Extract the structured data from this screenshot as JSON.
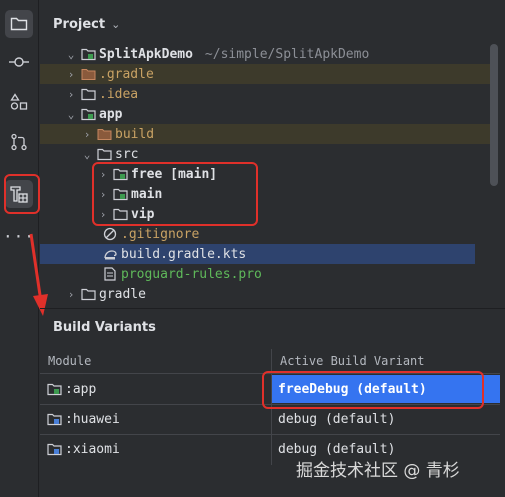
{
  "project": {
    "title": "Project",
    "chevron": "⌄"
  },
  "tree": {
    "root": {
      "name": "SplitApkDemo",
      "path": "~/simple/SplitApkDemo"
    },
    "gradle_dir": ".gradle",
    "idea_dir": ".idea",
    "app": "app",
    "build": "build",
    "src": "src",
    "src_children": [
      "free [main]",
      "main",
      "vip"
    ],
    "gitignore": ".gitignore",
    "build_gradle": "build.gradle.kts",
    "proguard": "proguard-rules.pro",
    "gradle": "gradle"
  },
  "build_variants": {
    "title": "Build Variants",
    "headers": {
      "module": "Module",
      "variant": "Active Build Variant"
    },
    "rows": [
      {
        "module": ":app",
        "variant": "freeDebug (default)"
      },
      {
        "module": ":huawei",
        "variant": "debug (default)"
      },
      {
        "module": ":xiaomi",
        "variant": "debug (default)"
      }
    ]
  },
  "toolstrip": [
    "folder-icon",
    "commit-icon",
    "structure-icon",
    "pull-request-icon",
    "build-variants-icon",
    "more-icon"
  ],
  "watermark": "掘金技术社区 @ 青杉",
  "colors": {
    "background": "#2b2d30",
    "selection": "#3574f0",
    "annotation": "#e0302a",
    "excluded_folder": "#c9a264"
  }
}
